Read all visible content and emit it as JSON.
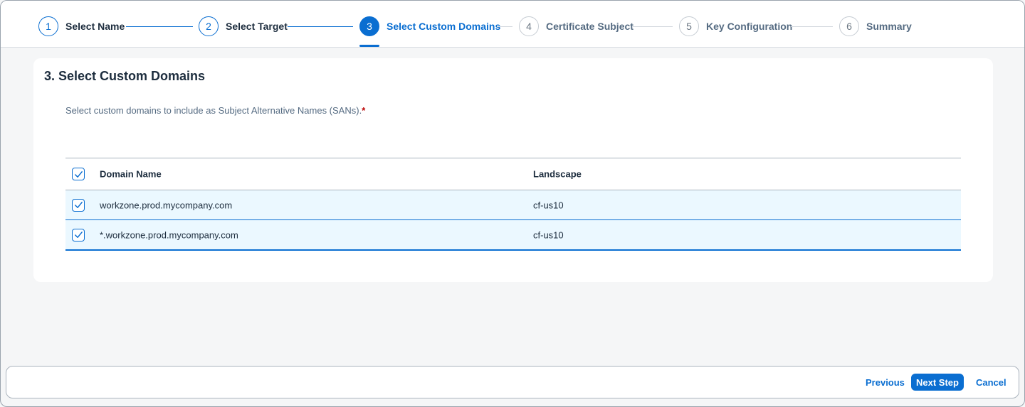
{
  "steps": [
    {
      "number": "1",
      "label": "Select Name",
      "state": "done"
    },
    {
      "number": "2",
      "label": "Select Target",
      "state": "done"
    },
    {
      "number": "3",
      "label": "Select Custom Domains",
      "state": "active"
    },
    {
      "number": "4",
      "label": "Certificate Subject",
      "state": "future"
    },
    {
      "number": "5",
      "label": "Key Configuration",
      "state": "future"
    },
    {
      "number": "6",
      "label": "Summary",
      "state": "future"
    }
  ],
  "section": {
    "title": "3. Select Custom Domains",
    "instruction": "Select custom domains to include as Subject Alternative Names (SANs).",
    "required_marker": "*"
  },
  "table": {
    "columns": [
      "Domain Name",
      "Landscape"
    ],
    "header_checked": true,
    "rows": [
      {
        "domain": "workzone.prod.mycompany.com",
        "landscape": "cf-us10",
        "checked": true
      },
      {
        "domain": "*.workzone.prod.mycompany.com",
        "landscape": "cf-us10",
        "checked": true
      }
    ]
  },
  "footer": {
    "previous_label": "Previous",
    "next_label": "Next Step",
    "cancel_label": "Cancel"
  },
  "colors": {
    "accent": "#0a6ed1",
    "selected_row": "#ebf8ff",
    "required": "#bb0000"
  }
}
